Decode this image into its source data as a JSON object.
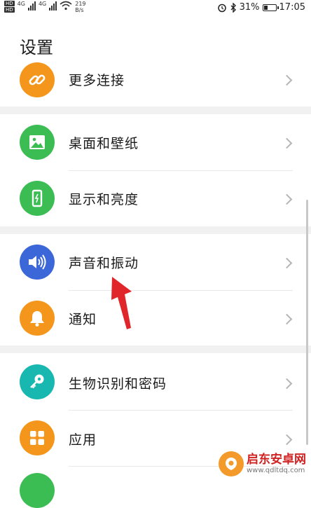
{
  "status_bar": {
    "hd1": "HD",
    "hd2": "HD",
    "net1": "4G",
    "net2": "4G",
    "speed_value": "219",
    "speed_unit": "B/s",
    "battery_percent": "31%",
    "battery_level": 0.31,
    "time": "17:05"
  },
  "page": {
    "title": "设置"
  },
  "settings": [
    {
      "label": "更多连接",
      "icon": "link-icon",
      "color": "#f5961c"
    },
    {
      "label": "桌面和壁纸",
      "icon": "image-icon",
      "color": "#3cbd54"
    },
    {
      "label": "显示和亮度",
      "icon": "phone-display-icon",
      "color": "#3cbd54"
    },
    {
      "label": "声音和振动",
      "icon": "speaker-icon",
      "color": "#3b67d8"
    },
    {
      "label": "通知",
      "icon": "bell-icon",
      "color": "#f5961c"
    },
    {
      "label": "生物识别和密码",
      "icon": "key-icon",
      "color": "#18b8b0"
    },
    {
      "label": "应用",
      "icon": "apps-grid-icon",
      "color": "#f5961c"
    }
  ],
  "watermark": {
    "name": "启东安卓网",
    "url": "www.qdltdq.com"
  },
  "accent": {
    "arrow": "#e0262a"
  }
}
